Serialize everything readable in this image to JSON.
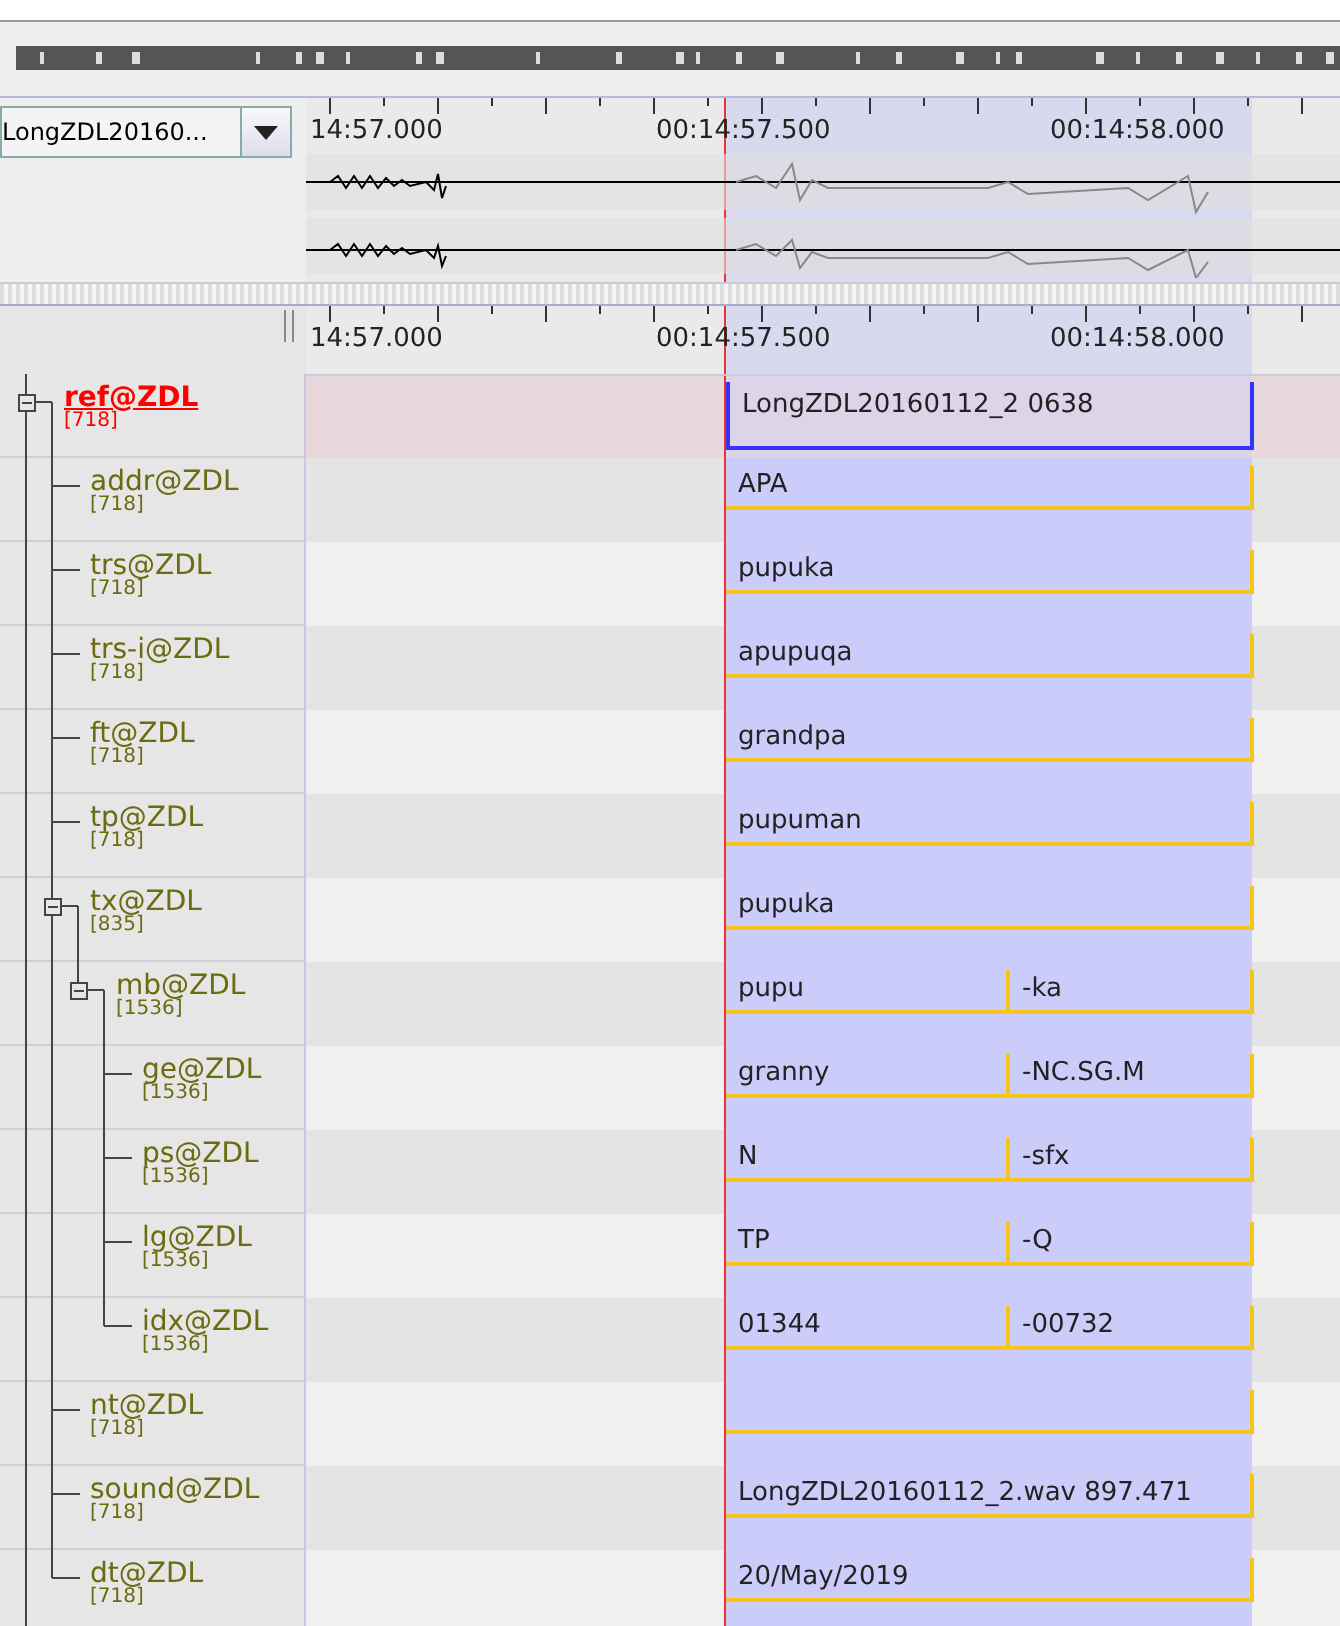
{
  "media_selector": {
    "value": "LongZDL20160..."
  },
  "waveform_ruler": {
    "labels": [
      "14:57.000",
      "00:14:57.500",
      "00:14:58.000"
    ]
  },
  "timeline_ruler": {
    "labels": [
      "14:57.000",
      "00:14:57.500",
      "00:14:58.000"
    ]
  },
  "tiers": [
    {
      "name": "ref@ZDL",
      "count": "[718]",
      "selected": true,
      "expanded": true,
      "annotations": [
        {
          "text": "LongZDL20160112_2 0638"
        }
      ],
      "children": [
        {
          "name": "addr@ZDL",
          "count": "[718]",
          "selected": false,
          "annotations": [
            {
              "text": "APA"
            }
          ]
        },
        {
          "name": "trs@ZDL",
          "count": "[718]",
          "selected": false,
          "annotations": [
            {
              "text": "pupuka"
            }
          ]
        },
        {
          "name": "trs-i@ZDL",
          "count": "[718]",
          "selected": false,
          "annotations": [
            {
              "text": "apupuqa"
            }
          ]
        },
        {
          "name": "ft@ZDL",
          "count": "[718]",
          "selected": false,
          "annotations": [
            {
              "text": "grandpa"
            }
          ]
        },
        {
          "name": "tp@ZDL",
          "count": "[718]",
          "selected": false,
          "annotations": [
            {
              "text": "pupuman"
            }
          ]
        },
        {
          "name": "tx@ZDL",
          "count": "[835]",
          "selected": false,
          "expanded": true,
          "annotations": [
            {
              "text": "pupuka"
            }
          ],
          "children": [
            {
              "name": "mb@ZDL",
              "count": "[1536]",
              "selected": false,
              "expanded": true,
              "annotations": [
                {
                  "text": "pupu"
                },
                {
                  "text": "-ka"
                }
              ],
              "children": [
                {
                  "name": "ge@ZDL",
                  "count": "[1536]",
                  "selected": false,
                  "annotations": [
                    {
                      "text": "granny"
                    },
                    {
                      "text": "-NC.SG.M"
                    }
                  ]
                },
                {
                  "name": "ps@ZDL",
                  "count": "[1536]",
                  "selected": false,
                  "annotations": [
                    {
                      "text": "N"
                    },
                    {
                      "text": "-sfx"
                    }
                  ]
                },
                {
                  "name": "lg@ZDL",
                  "count": "[1536]",
                  "selected": false,
                  "annotations": [
                    {
                      "text": "TP"
                    },
                    {
                      "text": "-Q"
                    }
                  ]
                },
                {
                  "name": "idx@ZDL",
                  "count": "[1536]",
                  "selected": false,
                  "annotations": [
                    {
                      "text": "01344"
                    },
                    {
                      "text": "-00732"
                    }
                  ]
                }
              ]
            }
          ]
        },
        {
          "name": "nt@ZDL",
          "count": "[718]",
          "selected": false,
          "annotations": [
            {
              "kind": "blank"
            }
          ]
        },
        {
          "name": "sound@ZDL",
          "count": "[718]",
          "selected": false,
          "annotations": [
            {
              "text": "LongZDL20160112_2.wav 897.471"
            }
          ]
        },
        {
          "name": "dt@ZDL",
          "count": "[718]",
          "selected": false,
          "annotations": [
            {
              "text": "20/May/2019"
            }
          ]
        }
      ]
    }
  ]
}
